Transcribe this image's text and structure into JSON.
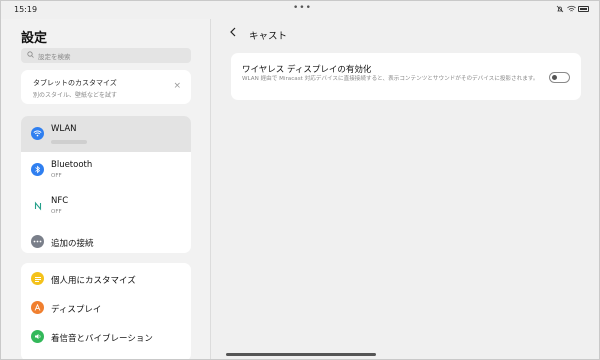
{
  "status": {
    "time": "15:19",
    "dots": "•••",
    "icons": [
      "dnd-icon",
      "wifi-icon",
      "battery-icon"
    ]
  },
  "left": {
    "title": "設定",
    "search_placeholder": "設定を検索",
    "tip": {
      "title": "タブレットのカスタマイズ",
      "subtitle": "別のスタイル、壁紙などを試す",
      "close": "×"
    },
    "network": [
      {
        "label": "WLAN",
        "sub": "",
        "icon": "wifi-icon",
        "color": "#2f7ff0",
        "selected": true
      },
      {
        "label": "Bluetooth",
        "sub": "OFF",
        "icon": "bluetooth-icon",
        "color": "#2f7ff0"
      },
      {
        "label": "NFC",
        "sub": "OFF",
        "icon": "nfc-icon",
        "color": "#25a08a"
      },
      {
        "label": "追加の接続",
        "sub": "",
        "icon": "more-icon",
        "color": "#7a7f8a"
      }
    ],
    "personal": [
      {
        "label": "個人用にカスタマイズ",
        "icon": "palette-icon",
        "color": "#f4c21b"
      },
      {
        "label": "ディスプレイ",
        "icon": "display-icon",
        "color": "#f07f2f"
      },
      {
        "label": "着信音とバイブレーション",
        "icon": "sound-icon",
        "color": "#33b85a"
      }
    ]
  },
  "right": {
    "back": "<",
    "title": "キャスト",
    "cast": {
      "title": "ワイヤレス ディスプレイの有効化",
      "description": "WLAN 経由で Miracast 対応デバイスに直接接続すると、表示コンテンツとサウンドがそのデバイスに投影されます。",
      "enabled": false
    }
  }
}
